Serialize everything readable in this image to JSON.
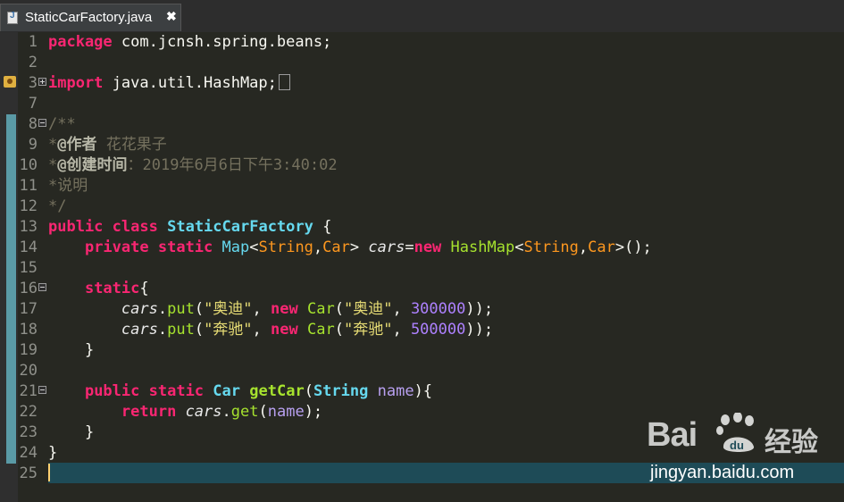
{
  "tab": {
    "filename": "StaticCarFactory.java",
    "close_glyph": "✖"
  },
  "colors": {
    "keyword": "#f92672",
    "type": "#66d9ef",
    "string": "#e6db74",
    "number": "#ae81ff",
    "comment": "#75715e",
    "background": "#272822",
    "current_line": "#1e4b57"
  },
  "line_numbers": [
    "1",
    "2",
    "3",
    "7",
    "8",
    "9",
    "10",
    "11",
    "12",
    "13",
    "14",
    "15",
    "16",
    "17",
    "18",
    "19",
    "20",
    "21",
    "22",
    "23",
    "24",
    "25"
  ],
  "code": {
    "l1_kw": "package",
    "l1_rest": " com.jcnsh.spring.beans;",
    "l3_kw": "import",
    "l3_rest": " java.util.HashMap;",
    "l8": "/**",
    "l9_star": "*",
    "l9_tag": "@作者",
    "l9_text": " 花花果子",
    "l10_star": "*",
    "l10_tag": "@创建时间",
    "l10_text": "：2019年6月6日下午3:40:02",
    "l11": "*说明",
    "l12": "*/",
    "l13_kw1": "public",
    "l13_kw2": "class",
    "l13_name": "StaticCarFactory",
    "l13_brace": " {",
    "l14_kw1": "private",
    "l14_kw2": "static",
    "l14_map": "Map",
    "l14_t1": "String",
    "l14_t2": "Car",
    "l14_field": "cars",
    "l14_new": "new",
    "l14_hashmap": "HashMap",
    "l14_t3": "String",
    "l14_t4": "Car",
    "l16_kw": "static",
    "l16_brace": "{",
    "l17_field": "cars",
    "l17_method": "put",
    "l17_key": "\"奥迪\"",
    "l17_new": "new",
    "l17_car": "Car",
    "l17_str": "\"奥迪\"",
    "l17_num": "300000",
    "l18_field": "cars",
    "l18_method": "put",
    "l18_key": "\"奔驰\"",
    "l18_new": "new",
    "l18_car": "Car",
    "l18_str": "\"奔驰\"",
    "l18_num": "500000",
    "l19": "}",
    "l21_kw1": "public",
    "l21_kw2": "static",
    "l21_ret": "Car",
    "l21_name": "getCar",
    "l21_ptype": "String",
    "l21_pname": "name",
    "l22_kw": "return",
    "l22_field": "cars",
    "l22_method": "get",
    "l22_arg": "name",
    "l23": "}",
    "l24": "}"
  },
  "watermark": {
    "brand_left": "Bai",
    "brand_right": "du",
    "brand_cn": "经验",
    "url": "jingyan.baidu.com",
    "paw_icon": "baidu-paw-icon"
  }
}
